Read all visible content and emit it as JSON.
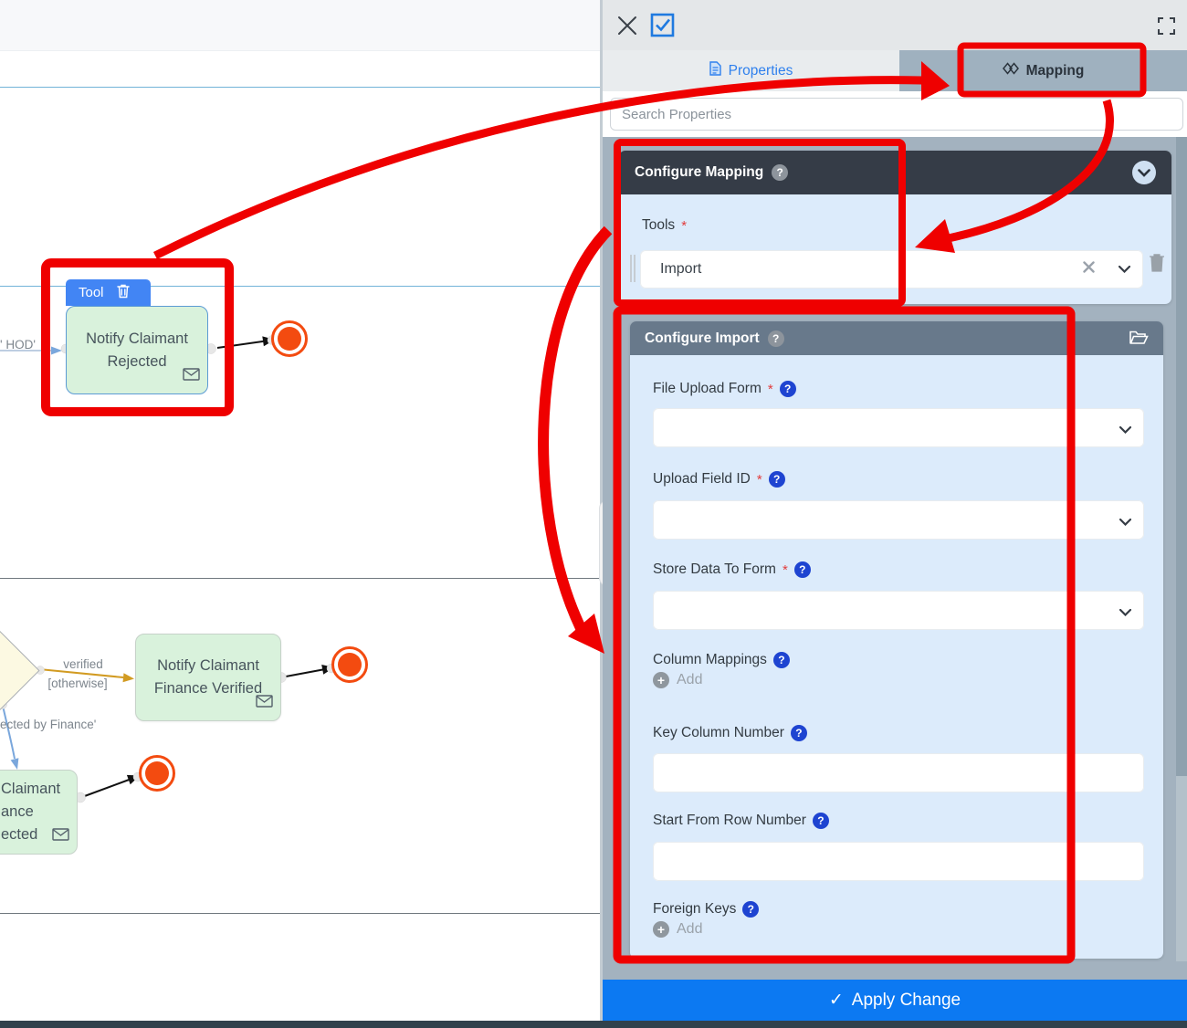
{
  "canvas": {
    "hod_label": "' HOD'",
    "tool_badge_label": "Tool",
    "node_rejected": {
      "line1": "Notify Claimant",
      "line2": "Rejected"
    },
    "node_finance_verified": {
      "line1": "Notify Claimant",
      "line2": "Finance Verified"
    },
    "node_finance_rejected": {
      "line1": "Claimant",
      "line2": "ance",
      "line3": "ected"
    },
    "edge_labels": {
      "verified": "verified",
      "otherwise": "[otherwise]",
      "rejected_by_finance": "ected by Finance'"
    }
  },
  "panel": {
    "tabs": {
      "properties": "Properties",
      "mapping": "Mapping"
    },
    "search_placeholder": "Search Properties",
    "required_marker": "*",
    "help_glyph": "?",
    "add_plus": "+",
    "mapping_card": {
      "title": "Configure Mapping",
      "tools_label": "Tools",
      "tools_value": "Import"
    },
    "import_card": {
      "title": "Configure Import",
      "fields": [
        {
          "label": "File Upload Form",
          "required": true,
          "type": "select"
        },
        {
          "label": "Upload Field ID",
          "required": true,
          "type": "select"
        },
        {
          "label": "Store Data To Form",
          "required": true,
          "type": "select"
        },
        {
          "label": "Column Mappings",
          "type": "add",
          "add_label": "Add"
        },
        {
          "label": "Key Column Number",
          "type": "input"
        },
        {
          "label": "Start From Row Number",
          "type": "input"
        },
        {
          "label": "Foreign Keys",
          "type": "add",
          "add_label": "Add"
        }
      ]
    },
    "apply_check": "✓",
    "apply_label": "Apply Change"
  },
  "colors": {
    "annotation_red": "#ef0000",
    "apply_blue": "#0c79f2",
    "end_event_orange": "#f34b10",
    "node_green": "#d9f2dc",
    "panel_gray": "#a3b2bf",
    "card1_header": "#353c47",
    "card2_header": "#68798b",
    "body_blue": "#dcebfb"
  }
}
